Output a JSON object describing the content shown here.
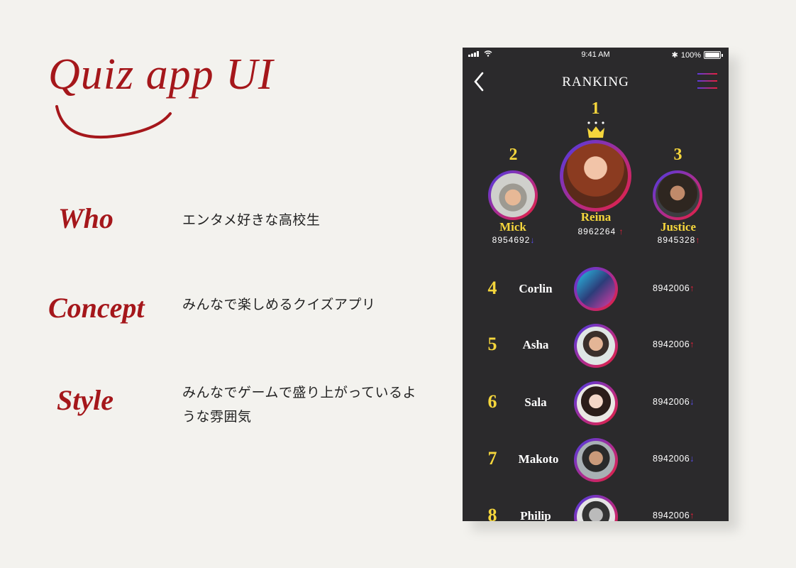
{
  "intro": {
    "title": "Quiz app UI",
    "sections": [
      {
        "label": "Who",
        "text": "エンタメ好きな高校生"
      },
      {
        "label": "Concept",
        "text": "みんなで楽しめるクイズアプリ"
      },
      {
        "label": "Style",
        "text": "みんなでゲームで盛り上がっているような雰囲気"
      }
    ]
  },
  "phone": {
    "status": {
      "time": "9:41 AM",
      "battery": "100%"
    },
    "nav_title": "RANKING",
    "podium": [
      {
        "rank": "1",
        "name": "Reina",
        "score": "8962264",
        "trend": "up"
      },
      {
        "rank": "2",
        "name": "Mick",
        "score": "8954692",
        "trend": "down"
      },
      {
        "rank": "3",
        "name": "Justice",
        "score": "8945328",
        "trend": "up"
      }
    ],
    "list": [
      {
        "rank": "4",
        "name": "Corlin",
        "score": "8942006",
        "trend": "up"
      },
      {
        "rank": "5",
        "name": "Asha",
        "score": "8942006",
        "trend": "up"
      },
      {
        "rank": "6",
        "name": "Sala",
        "score": "8942006",
        "trend": "down"
      },
      {
        "rank": "7",
        "name": "Makoto",
        "score": "8942006",
        "trend": "down"
      },
      {
        "rank": "8",
        "name": "Philip",
        "score": "8942006",
        "trend": "up"
      }
    ],
    "colors": {
      "accent_gold": "#f5d63c",
      "up": "#e8203a",
      "down": "#5b4ef0",
      "background": "#2b2a2c"
    }
  }
}
